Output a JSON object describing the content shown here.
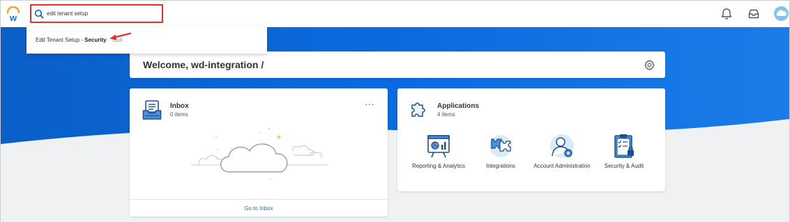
{
  "header": {
    "search": {
      "value": "edit tenant setup",
      "placeholder": "Search"
    },
    "icons": [
      "workday-logo",
      "bell-icon",
      "inbox-tray-icon",
      "avatar"
    ]
  },
  "dropdown": {
    "result": {
      "prefix": "Edit Tenant Setup - ",
      "category": "Security",
      "separator": " · ",
      "type": "Task"
    }
  },
  "welcome": {
    "title": "Welcome, wd-integration /"
  },
  "inbox": {
    "title": "Inbox",
    "count": "0 items",
    "footer_link": "Go to Inbox"
  },
  "applications": {
    "title": "Applications",
    "count": "4 items",
    "items": [
      {
        "label": "Reporting & Analytics",
        "icon": "reporting-analytics-icon"
      },
      {
        "label": "Integrations",
        "icon": "integrations-icon"
      },
      {
        "label": "Account Administration",
        "icon": "account-administration-icon"
      },
      {
        "label": "Security & Audit",
        "icon": "security-audit-icon"
      }
    ]
  },
  "colors": {
    "brand_blue": "#0875e1",
    "highlight_red": "#e0312a",
    "link_blue": "#1a6fcc"
  }
}
